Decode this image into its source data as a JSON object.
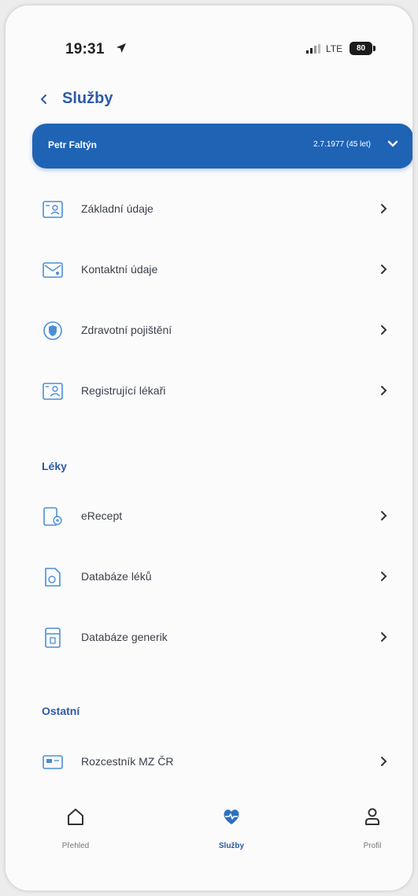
{
  "status_bar": {
    "time": "19:31",
    "network": "LTE",
    "battery": "80"
  },
  "header": {
    "title": "Služby"
  },
  "user": {
    "name": "Petr Faltýn",
    "dob": "2.7.1977 (45 let)"
  },
  "sections": [
    {
      "title": "",
      "items": [
        {
          "label": "Základní údaje",
          "icon": "id-card-icon"
        },
        {
          "label": "Kontaktní údaje",
          "icon": "contact-card-icon"
        },
        {
          "label": "Zdravotní pojištění",
          "icon": "shield-icon"
        },
        {
          "label": "Registrující lékaři",
          "icon": "doctor-card-icon"
        }
      ]
    },
    {
      "title": "Léky",
      "items": [
        {
          "label": "eRecept",
          "icon": "prescription-icon"
        },
        {
          "label": "Databáze léků",
          "icon": "medicine-document-icon"
        },
        {
          "label": "Databáze generik",
          "icon": "medicine-box-icon"
        }
      ]
    },
    {
      "title": "Ostatní",
      "items": [
        {
          "label": "Rozcestník MZ ČR",
          "icon": "signpost-card-icon"
        }
      ]
    }
  ],
  "bottom_nav": [
    {
      "label": "Přehled",
      "icon": "home-icon",
      "active": false
    },
    {
      "label": "Služby",
      "icon": "heart-pulse-icon",
      "active": true
    },
    {
      "label": "Profil",
      "icon": "person-icon",
      "active": false
    }
  ],
  "colors": {
    "accent": "#1f63b5",
    "title": "#2d5aa6",
    "icon": "#4a8fd6"
  }
}
